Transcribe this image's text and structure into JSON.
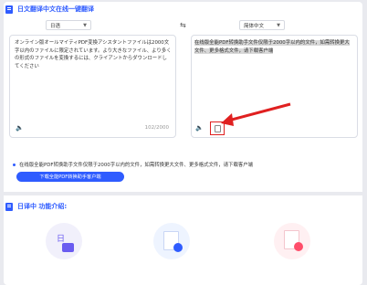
{
  "header": {
    "title": "日文翻译中文在线一键翻译"
  },
  "source": {
    "language": "日语",
    "text": "オンライン版オールマイティPDF変換アシスタントファイルは2000文字以内のファイルに限定されています。より大きなファイル、より多くの形式のファイルを変換するには、クライアントからダウンロードしてください",
    "counter": "102/2000"
  },
  "target": {
    "language": "简体中文",
    "text": "在线版全能PDF转换助手文件仅限于2000字以内的文件，如需转换更大文件、更多格式文件，请下载客户端"
  },
  "icons": {
    "swap": "⇆",
    "speaker": "🔈"
  },
  "notice": {
    "text": "在线版全能PDF转换助手文件仅限于2000字以内的文件，如需转换更大文件、更多格式文件，请下载客户端"
  },
  "download_button": {
    "label": "下载全能PDF转换助手客户端"
  },
  "intro": {
    "title": "日译中 功能介绍:"
  },
  "colors": {
    "accent": "#2f5cff",
    "highlight_box": "#e02020"
  }
}
